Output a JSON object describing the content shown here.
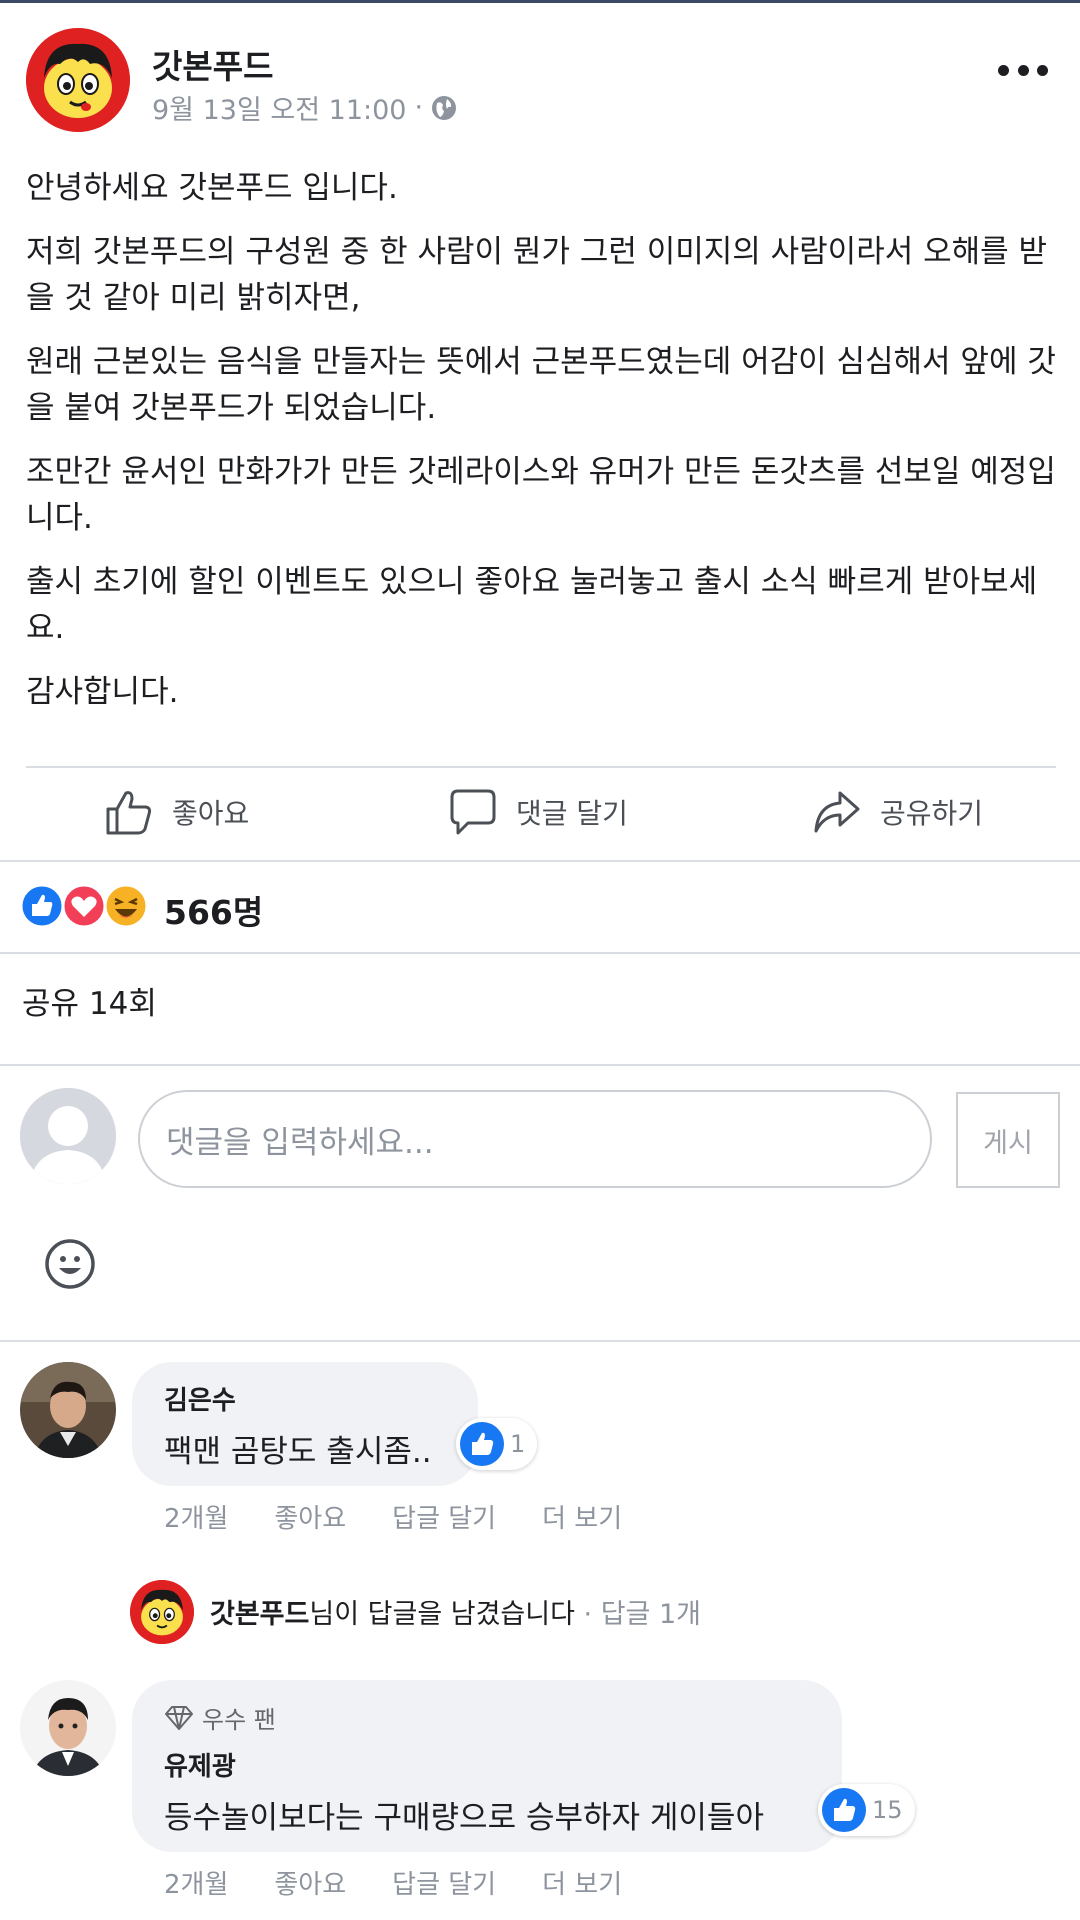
{
  "post": {
    "page_name": "갓본푸드",
    "date": "9월 13일 오전 11:00",
    "meta_sep": "·",
    "paragraphs": [
      "안녕하세요 갓본푸드 입니다.",
      "저희 갓본푸드의 구성원 중 한 사람이 뭔가 그런 이미지의 사람이라서 오해를 받을 것 같아 미리 밝히자면,",
      "원래 근본있는 음식을 만들자는 뜻에서 근본푸드였는데 어감이 심심해서 앞에 갓을 붙여 갓본푸드가 되었습니다.",
      "조만간 윤서인 만화가가 만든 갓레라이스와 유머가 만든 돈갓츠를 선보일 예정입니다.",
      "출시 초기에 할인 이벤트도 있으니 좋아요 눌러놓고 출시 소식 빠르게 받아보세요.",
      "감사합니다."
    ]
  },
  "actions": {
    "like": "좋아요",
    "comment": "댓글 달기",
    "share": "공유하기"
  },
  "reactions": {
    "count": "566명",
    "shares": "공유 14회"
  },
  "comment_box": {
    "placeholder": "댓글을 입력하세요...",
    "post_label": "게시"
  },
  "comments": [
    {
      "author": "김은수",
      "text": "팩맨 곰탕도 출시좀..",
      "likes": "1",
      "time": "2개월",
      "like_label": "좋아요",
      "reply_label": "답글 달기",
      "more_label": "더 보기",
      "reply_summary": {
        "name": "갓본푸드",
        "suffix": "님이 답글을 남겼습니다",
        "count": "· 답글 1개"
      }
    },
    {
      "badge": "우수 팬",
      "author": "유제광",
      "text": "등수놀이보다는 구매량으로 승부하자 게이들아",
      "likes": "15",
      "time": "2개월",
      "like_label": "좋아요",
      "reply_label": "답글 달기",
      "more_label": "더 보기"
    }
  ],
  "colors": {
    "brand_red": "#e02121",
    "like_blue": "#1877f2",
    "love_red": "#f33e58",
    "haha_yellow": "#f7b125"
  }
}
